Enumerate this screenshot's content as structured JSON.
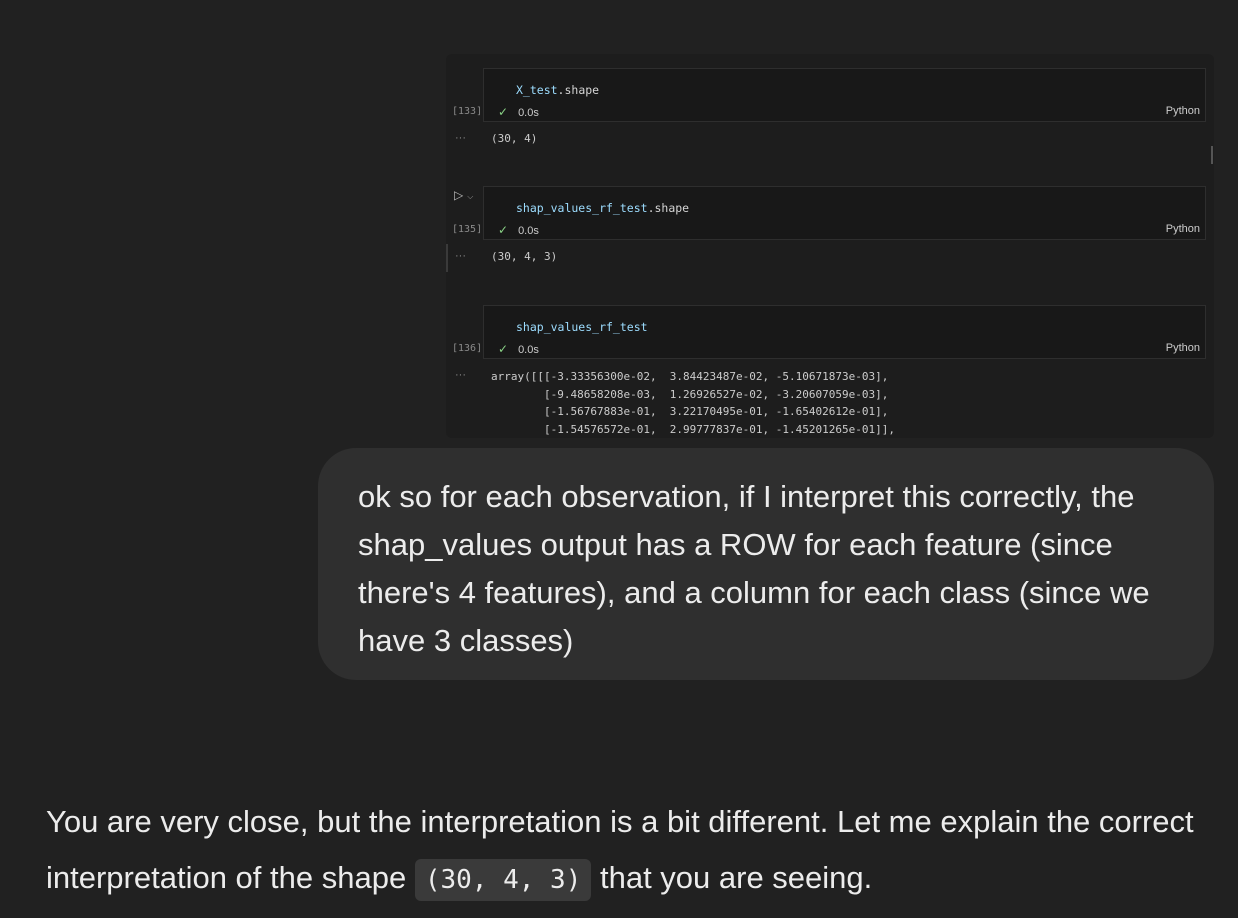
{
  "notebook": {
    "cells": [
      {
        "exec_count": "[133]",
        "code_var": "X_test",
        "code_attr": ".shape",
        "status_time": "0.0s",
        "language": "Python",
        "output_marker": "···",
        "output": "(30, 4)"
      },
      {
        "exec_count": "[135]",
        "code_var": "shap_values_rf_test",
        "code_attr": ".shape",
        "status_time": "0.0s",
        "language": "Python",
        "output_marker": "···",
        "output": "(30, 4, 3)"
      },
      {
        "exec_count": "[136]",
        "code_var": "shap_values_rf_test",
        "code_attr": "",
        "status_time": "0.0s",
        "language": "Python",
        "output_marker": "···",
        "output": "array([[[-3.33356300e-02,  3.84423487e-02, -5.10671873e-03],\n        [-9.48658208e-03,  1.26926527e-02, -3.20607059e-03],\n        [-1.56767883e-01,  3.22170495e-01, -1.65402612e-01],\n        [-1.54576572e-01,  2.99777837e-01, -1.45201265e-01]],"
      }
    ],
    "icons": {
      "check": "✓",
      "run": "▷",
      "chevron": "⌵"
    }
  },
  "user_message": {
    "text": "ok so for each observation, if I interpret this correctly, the shap_values output has a ROW for each feature (since there's 4 features), and a column for each class (since we have 3 classes)"
  },
  "assistant_message": {
    "text_before": "You are very close, but the interpretation is a bit different. Let me explain the correct interpretation of the shape ",
    "inline_code": "(30, 4, 3)",
    "text_after": " that you are seeing."
  }
}
